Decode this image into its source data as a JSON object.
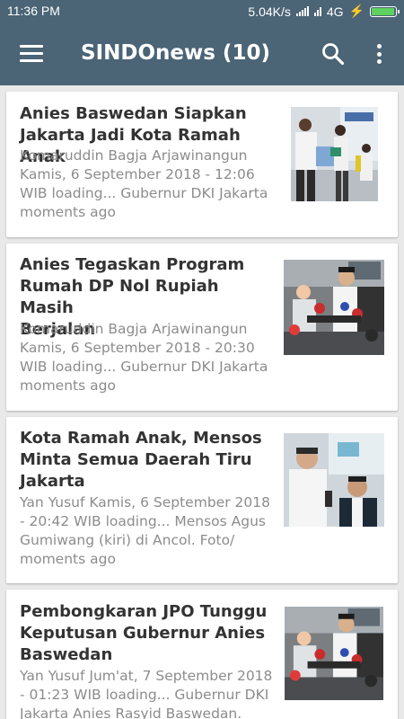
{
  "status_bar": {
    "time": "11:36 PM",
    "speed": "5.04K/s",
    "network": "4G",
    "battery_level": 0.9,
    "battery_color": "#5fd15f"
  },
  "app_bar": {
    "title": "SINDOnews (10)",
    "color": "#4b6476",
    "icons": [
      "hamburger-menu-icon",
      "search-icon",
      "more-vert-icon"
    ]
  },
  "articles": [
    {
      "title": [
        "Anies Baswedan Siapkan",
        "Jakarta Jadi Kota Ramah Anak"
      ],
      "meta": [
        "Komaruddin Bagja Arjawinangun",
        "Kamis, 6 September 2018 - 12:06",
        "WIB loading... Gubernur DKI Jakarta",
        "moments ago"
      ]
    },
    {
      "title": [
        "Anies Tegaskan Program",
        "Rumah DP Nol Rupiah Masih",
        "Berjalan"
      ],
      "meta": [
        "Komaruddin Bagja Arjawinangun",
        "Kamis, 6 September 2018 - 20:30",
        "WIB loading... Gubernur DKI Jakarta",
        "moments ago"
      ]
    },
    {
      "title": [
        "Kota Ramah Anak, Mensos",
        "Minta Semua Daerah Tiru",
        "Jakarta"
      ],
      "meta": [
        "Yan Yusuf Kamis, 6 September 2018",
        "- 20:42 WIB loading... Mensos Agus",
        "Gumiwang (kiri) di Ancol. Foto/",
        "moments ago"
      ]
    },
    {
      "title": [
        "Pembongkaran JPO Tunggu",
        "Keputusan Gubernur Anies",
        "Baswedan"
      ],
      "meta": [
        "Yan Yusuf Jum'at, 7 September 2018",
        "- 01:23 WIB loading... Gubernur DKI",
        "Jakarta Anies Rasyid Baswedan."
      ]
    }
  ]
}
